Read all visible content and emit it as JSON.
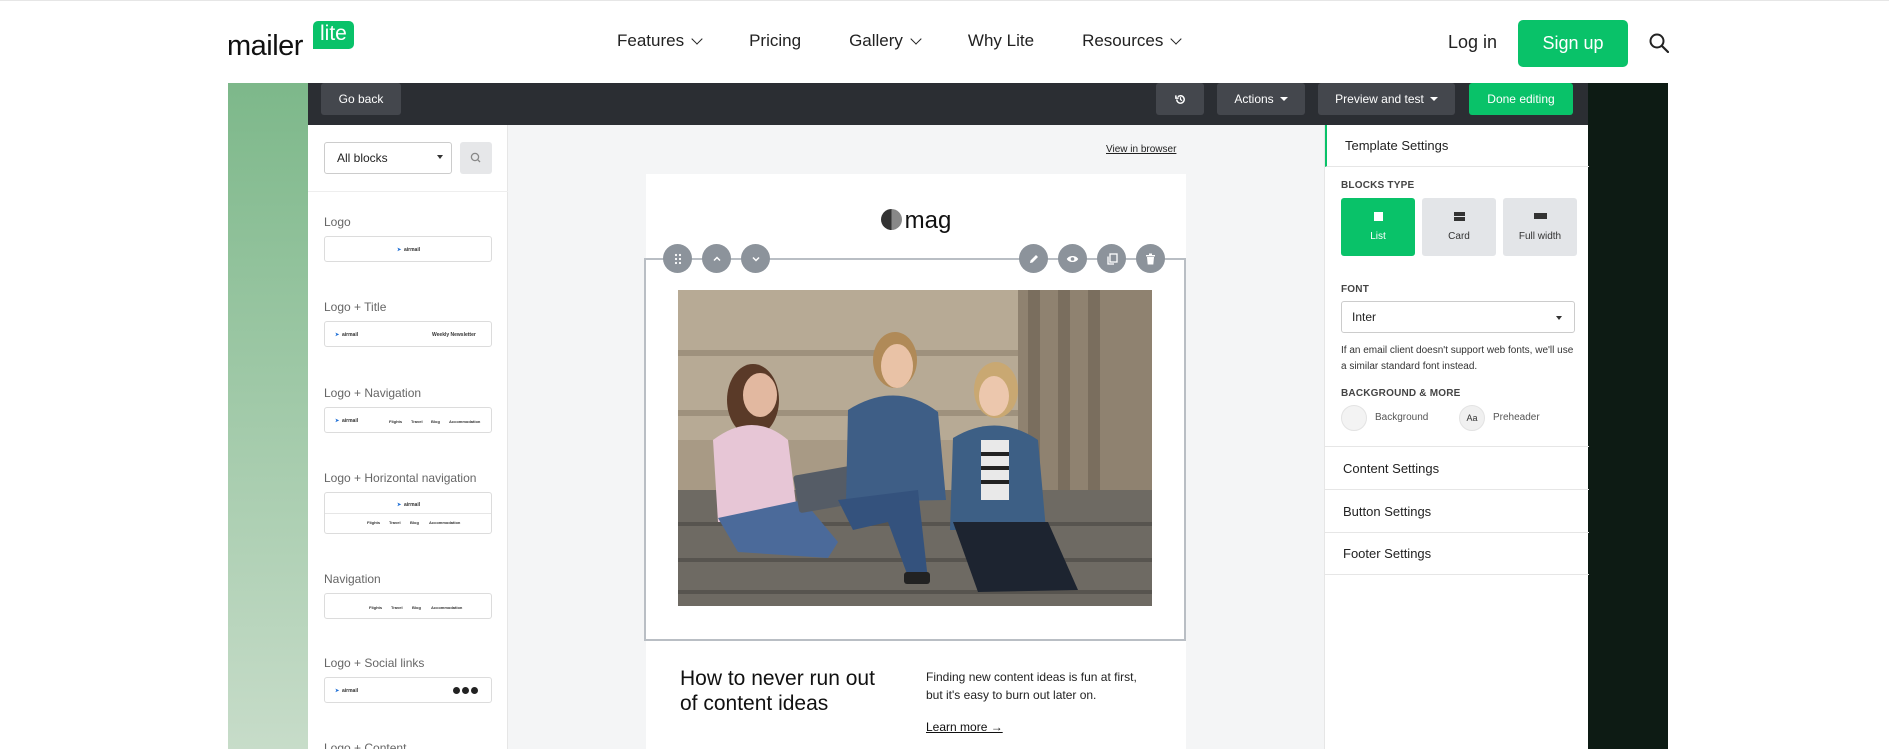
{
  "nav": {
    "logo_text": "mailer",
    "logo_badge": "lite",
    "items": [
      {
        "label": "Features",
        "has_dropdown": true
      },
      {
        "label": "Pricing",
        "has_dropdown": false
      },
      {
        "label": "Gallery",
        "has_dropdown": true
      },
      {
        "label": "Why Lite",
        "has_dropdown": false
      },
      {
        "label": "Resources",
        "has_dropdown": true
      }
    ],
    "login": "Log in",
    "signup": "Sign up",
    "search_icon": "search-icon"
  },
  "toolbar": {
    "go_back": "Go back",
    "history_icon": "history-icon",
    "actions": "Actions",
    "preview": "Preview and test",
    "done": "Done editing"
  },
  "left_panel": {
    "select_value": "All blocks",
    "blocks": [
      {
        "label": "Logo",
        "thumb": [
          "airmail"
        ]
      },
      {
        "label": "Logo + Title",
        "thumb": [
          "airmail",
          "Weekly Newsletter"
        ]
      },
      {
        "label": "Logo + Navigation",
        "thumb": [
          "airmail",
          "Flights",
          "Travel",
          "Blog",
          "Accommodation"
        ]
      },
      {
        "label": "Logo + Horizontal navigation",
        "thumb": [
          "airmail",
          "Flights",
          "Travel",
          "Blog",
          "Accommodation"
        ]
      },
      {
        "label": "Navigation",
        "thumb": [
          "Flights",
          "Travel",
          "Blog",
          "Accommodation"
        ]
      },
      {
        "label": "Logo + Social links",
        "thumb": [
          "airmail"
        ]
      },
      {
        "label": "Logo + Content",
        "thumb": []
      }
    ]
  },
  "canvas": {
    "view_in_browser": "View in browser",
    "brand": "mag",
    "headline": "How to never run out of content ideas",
    "body": "Finding new content ideas is fun at first, but it's easy to burn out later on.",
    "learn_more": "Learn more →"
  },
  "right_panel": {
    "title": "Template Settings",
    "blocks_type_label": "BLOCKS TYPE",
    "block_types": [
      {
        "label": "List",
        "active": true
      },
      {
        "label": "Card",
        "active": false
      },
      {
        "label": "Full width",
        "active": false
      }
    ],
    "font_label": "FONT",
    "font_value": "Inter",
    "font_note": "If an email client doesn't support web fonts, we'll use a similar standard font instead.",
    "bg_label": "BACKGROUND & MORE",
    "background": "Background",
    "preheader_badge": "Aa",
    "preheader": "Preheader",
    "sections": [
      "Content Settings",
      "Button Settings",
      "Footer Settings"
    ]
  },
  "colors": {
    "brand_green": "#09c269",
    "toolbar_dark": "#2b2e33",
    "toolbar_button": "#44474d"
  }
}
